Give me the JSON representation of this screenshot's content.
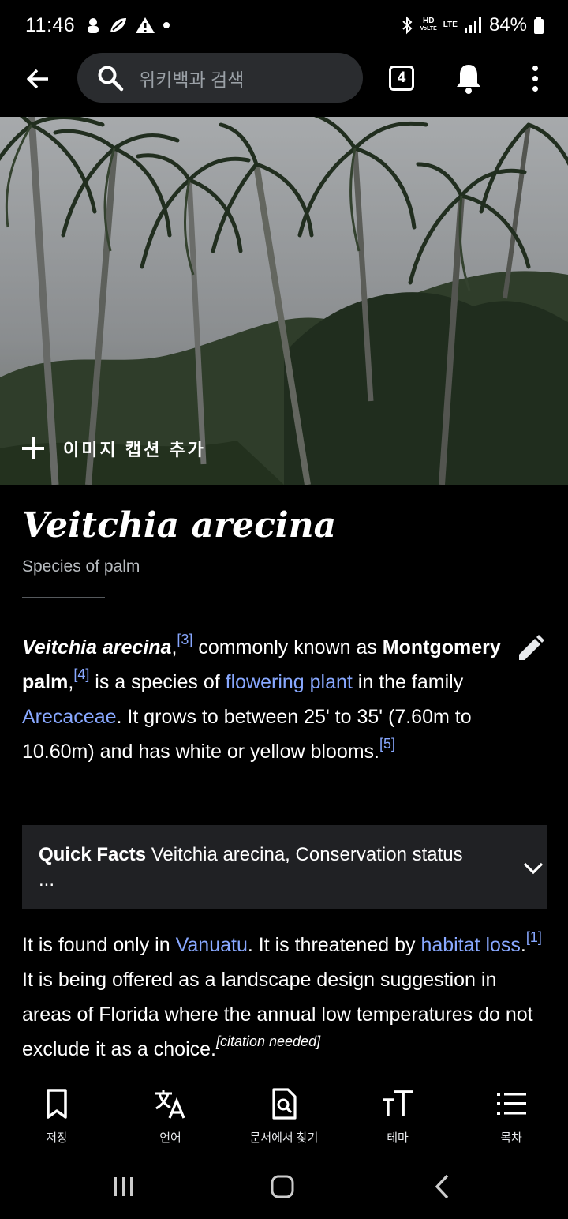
{
  "status_bar": {
    "time": "11:46",
    "hd_label": "HD",
    "voice_label": "VoLTE",
    "lte_label": "LTE",
    "battery": "84%"
  },
  "toolbar": {
    "search_placeholder": "위키백과 검색",
    "tab_count": "4"
  },
  "hero": {
    "caption_action": "이미지 캡션 추가"
  },
  "article": {
    "title": "Veitchia arecina",
    "description": "Species of palm",
    "p1": {
      "name": "Veitchia arecina",
      "ref3": "[3]",
      "t1": " commonly known as ",
      "common_name": "Montgomery palm",
      "ref4": "[4]",
      "t2": " is a species of ",
      "link_flowering": "flowering plant",
      "t3": " in the family ",
      "link_family": "Arecaceae",
      "t4": ". It grows to between 25' to 35' (7.60m to 10.60m) and has white or yellow blooms.",
      "ref5": "[5]"
    },
    "quick_facts": {
      "label": "Quick Facts",
      "text": " Veitchia arecina, Conservation status ..."
    },
    "p2": {
      "t1": "It is found only in ",
      "link_vanuatu": "Vanuatu",
      "t2": ". It is threatened by ",
      "link_habitat": "habitat loss",
      "t3": ".",
      "ref1": "[1]",
      "t4": " It is being offered as a landscape design suggestion in areas of Florida where the annual low temperatures do not exclude it as a choice.",
      "cite_needed": "[citation needed]"
    }
  },
  "bottom_nav": {
    "save": "저장",
    "language": "언어",
    "find": "문서에서 찾기",
    "theme": "테마",
    "contents": "목차"
  },
  "icons": [
    "back-arrow-icon",
    "search-icon",
    "tabs-icon",
    "bell-icon",
    "more-vert-icon",
    "plus-icon",
    "edit-pencil-icon",
    "chevron-down-icon",
    "bookmark-icon",
    "translate-icon",
    "find-in-page-icon",
    "text-size-icon",
    "list-icon"
  ]
}
